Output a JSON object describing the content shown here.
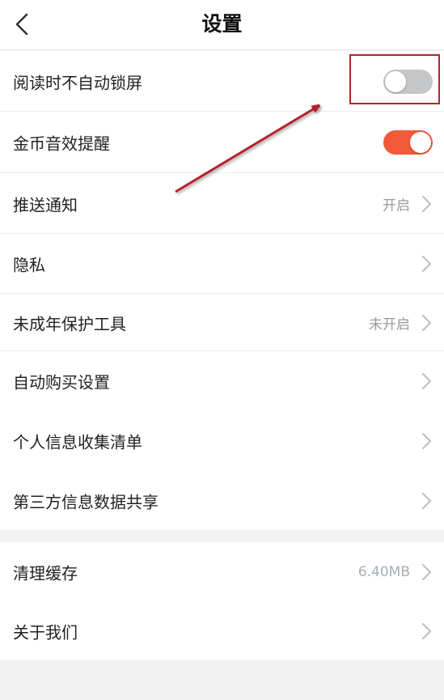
{
  "header": {
    "title": "设置",
    "back_icon": "chevron-left-icon"
  },
  "colors": {
    "accent": "#f05a3a",
    "toggle_off": "#c4c6c7",
    "annotation": "#b5242b",
    "value_text": "#9a9a9a"
  },
  "settings": {
    "no_auto_lock": {
      "label": "阅读时不自动锁屏",
      "enabled": false
    },
    "coin_sound": {
      "label": "金币音效提醒",
      "enabled": true
    },
    "push": {
      "label": "推送通知",
      "value": "开启"
    },
    "privacy": {
      "label": "隐私"
    },
    "minor_protection": {
      "label": "未成年保护工具",
      "value": "未开启"
    },
    "auto_purchase": {
      "label": "自动购买设置"
    },
    "personal_info_list": {
      "label": "个人信息收集清单"
    },
    "third_party_sharing": {
      "label": "第三方信息数据共享"
    }
  },
  "misc": {
    "clear_cache": {
      "label": "清理缓存",
      "value": "6.40MB"
    },
    "about": {
      "label": "关于我们"
    }
  }
}
